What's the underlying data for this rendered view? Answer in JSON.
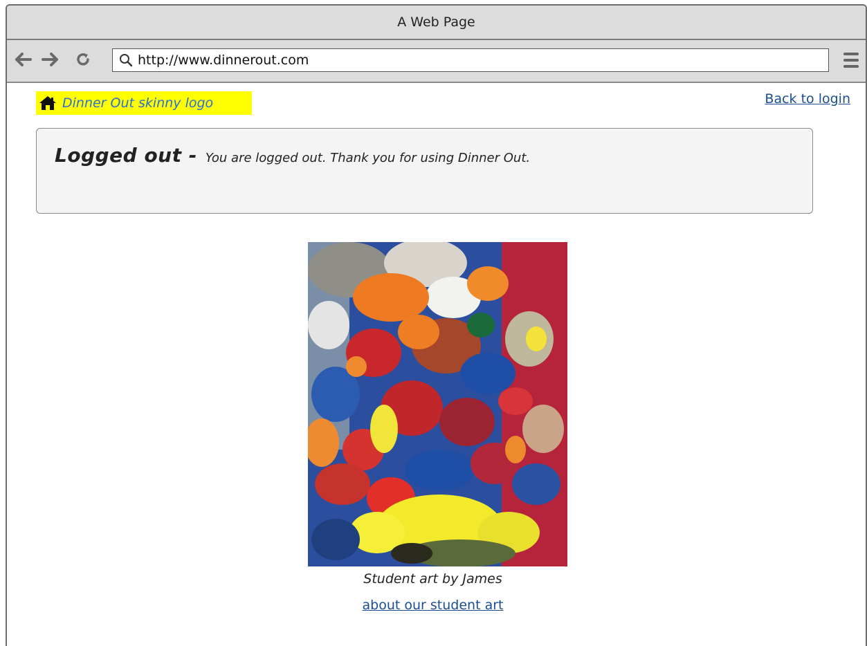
{
  "window": {
    "title": "A Web Page"
  },
  "browser": {
    "url": "http://www.dinnerout.com",
    "back_icon": "arrow-left-icon",
    "forward_icon": "arrow-right-icon",
    "reload_icon": "reload-icon",
    "menu_icon": "hamburger-menu-icon"
  },
  "header": {
    "logo_text": "Dinner Out skinny logo",
    "logo_bg": "#ffff00",
    "logo_text_color": "#2a6fd8",
    "back_link": "Back to login"
  },
  "notice": {
    "heading": "Logged out -",
    "message": "You are logged out. Thank you for using Dinner Out."
  },
  "art": {
    "caption": "Student art by James",
    "link": "about our student art"
  },
  "colors": {
    "link": "#1a4d8f",
    "chrome": "#dcdcdc"
  }
}
